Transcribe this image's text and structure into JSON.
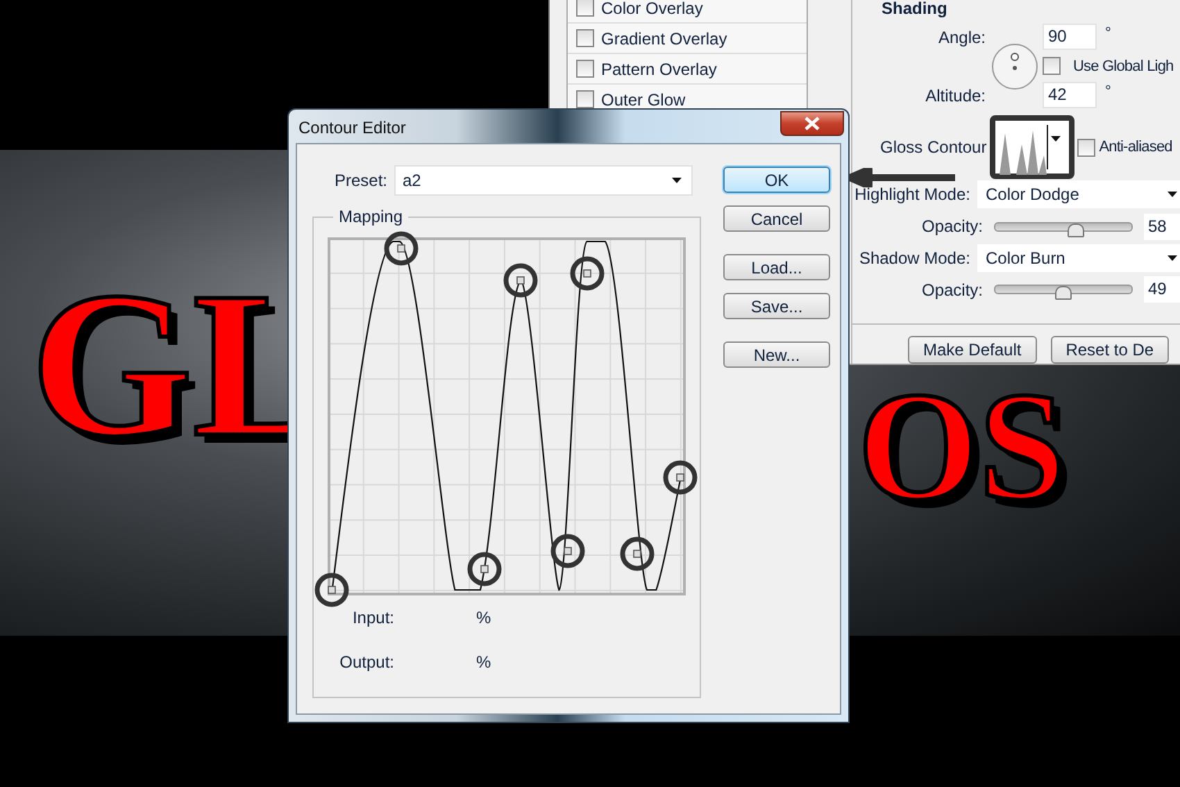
{
  "artwork_text": [
    "GL",
    "OS"
  ],
  "layer_style": {
    "effects": [
      {
        "label": "Color Overlay",
        "checked": false
      },
      {
        "label": "Gradient Overlay",
        "checked": false
      },
      {
        "label": "Pattern Overlay",
        "checked": false
      },
      {
        "label": "Outer Glow",
        "checked": false
      }
    ],
    "shading": {
      "title": "Shading",
      "angle": {
        "label": "Angle:",
        "value": "90",
        "unit": "°"
      },
      "use_global_light": {
        "label": "Use Global Ligh",
        "checked": false
      },
      "altitude": {
        "label": "Altitude:",
        "value": "42",
        "unit": "°"
      },
      "gloss_contour": {
        "label": "Gloss Contour"
      },
      "anti_aliased": {
        "label": "Anti-aliased",
        "checked": false
      },
      "highlight_mode": {
        "label": "Highlight Mode:",
        "value": "Color Dodge"
      },
      "highlight_opacity": {
        "label": "Opacity:",
        "level": 0.58,
        "value": "58"
      },
      "shadow_mode": {
        "label": "Shadow Mode:",
        "value": "Color Burn"
      },
      "shadow_opacity": {
        "label": "Opacity:",
        "level": 0.49,
        "value": "49"
      }
    },
    "buttons": [
      "Make Default",
      "Reset to De"
    ]
  },
  "contour_editor": {
    "title": "Contour Editor",
    "preset": {
      "label": "Preset:",
      "value": "a2"
    },
    "buttons": [
      {
        "label": "OK",
        "default": true
      },
      {
        "label": "Cancel",
        "default": false
      },
      {
        "label": "Load...",
        "default": false
      },
      {
        "label": "Save...",
        "default": false
      },
      {
        "label": "New...",
        "default": false
      }
    ],
    "mapping": {
      "title": "Mapping",
      "input": {
        "label": "Input:",
        "unit": "%"
      },
      "output": {
        "label": "Output:",
        "unit": "%"
      }
    }
  }
}
